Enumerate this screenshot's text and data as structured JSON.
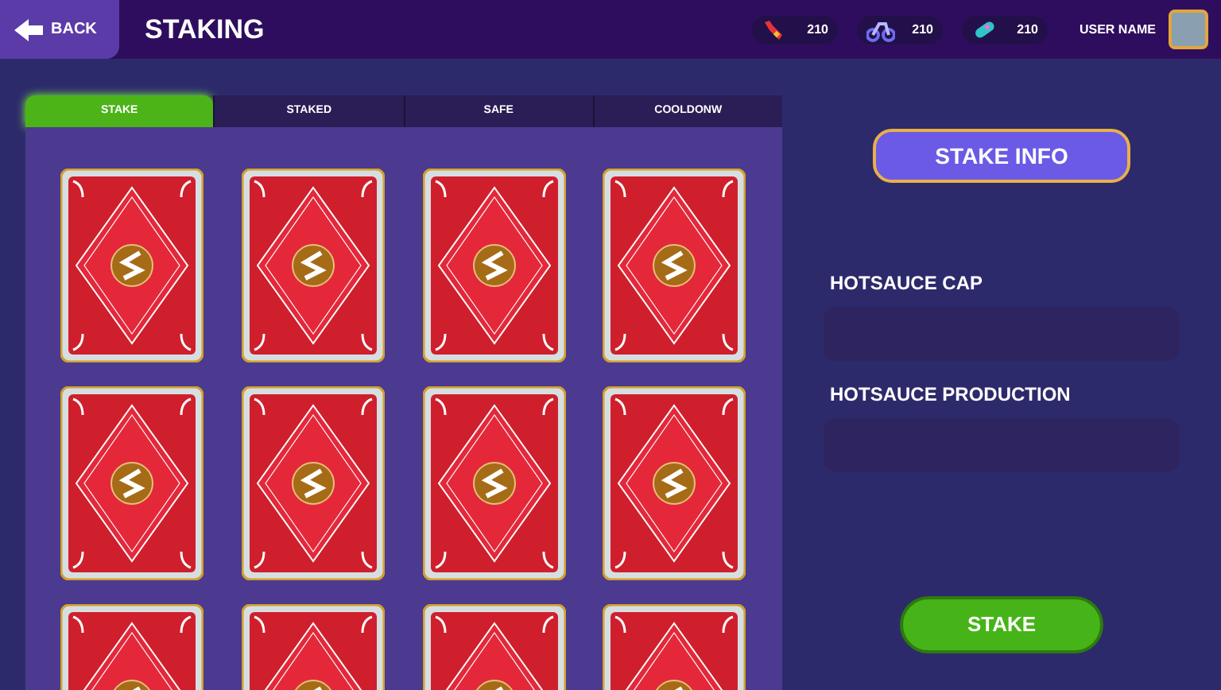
{
  "header": {
    "back_label": "BACK",
    "title": "STAKING",
    "user_name": "USER NAME"
  },
  "currencies": [
    {
      "kind": "bottle",
      "amount": "210"
    },
    {
      "kind": "bike",
      "amount": "210"
    },
    {
      "kind": "capsule",
      "amount": "210"
    }
  ],
  "tabs": [
    {
      "label": "STAKE",
      "selected": true
    },
    {
      "label": "STAKED",
      "selected": false
    },
    {
      "label": "SAFE",
      "selected": false
    },
    {
      "label": "COOLDONW",
      "selected": false
    }
  ],
  "cards": [
    {
      "kind": "card_back"
    },
    {
      "kind": "card_back"
    },
    {
      "kind": "card_back"
    },
    {
      "kind": "card_back"
    },
    {
      "kind": "card_back"
    },
    {
      "kind": "card_back"
    },
    {
      "kind": "card_back"
    },
    {
      "kind": "card_back"
    },
    {
      "kind": "card_back"
    },
    {
      "kind": "card_back"
    },
    {
      "kind": "card_back"
    },
    {
      "kind": "card_back"
    }
  ],
  "info": {
    "title": "STAKE INFO",
    "fields": [
      {
        "label": "HOTSAUCE CAP"
      },
      {
        "label": "HOTSAUCE PRODUCTION"
      }
    ]
  },
  "stake_button": "STAKE"
}
